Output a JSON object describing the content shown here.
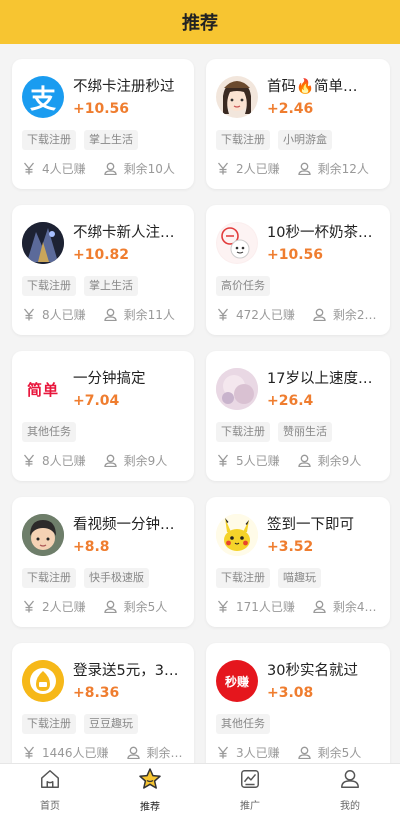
{
  "header": {
    "title": "推荐"
  },
  "cards": [
    {
      "title": "不绑卡注册秒过",
      "reward": "+10.56",
      "tags": [
        "下载注册",
        "掌上生活"
      ],
      "earned": "4人已赚",
      "remaining": "剩余10人",
      "avatar": {
        "type": "alipay",
        "text": "支",
        "bg": "#1a9cf0"
      }
    },
    {
      "title": "首码🔥简单…",
      "reward": "+2.46",
      "tags": [
        "下载注册",
        "小明游盒"
      ],
      "earned": "2人已赚",
      "remaining": "剩余12人",
      "avatar": {
        "type": "girl",
        "text": "",
        "bg": "#f2e6dc"
      }
    },
    {
      "title": "不绑卡新人注…",
      "reward": "+10.82",
      "tags": [
        "下载注册",
        "掌上生活"
      ],
      "earned": "8人已赚",
      "remaining": "剩余11人",
      "avatar": {
        "type": "dark",
        "text": "",
        "bg": "#1d2233"
      }
    },
    {
      "title": "10秒一杯奶茶…",
      "reward": "+10.56",
      "tags": [
        "高价任务"
      ],
      "earned": "472人已赚",
      "remaining": "剩余2…",
      "avatar": {
        "type": "stamp",
        "text": "",
        "bg": "#fbeeee"
      }
    },
    {
      "title": "一分钟搞定",
      "reward": "+7.04",
      "tags": [
        "其他任务"
      ],
      "earned": "8人已赚",
      "remaining": "剩余9人",
      "avatar": {
        "type": "text-red",
        "text": "简单",
        "bg": "#ffffff"
      }
    },
    {
      "title": "17岁以上速度…",
      "reward": "+26.4",
      "tags": [
        "下载注册",
        "赞丽生活"
      ],
      "earned": "5人已赚",
      "remaining": "剩余9人",
      "avatar": {
        "type": "blur",
        "text": "",
        "bg": "#e8d6e2"
      }
    },
    {
      "title": "看视频一分钟…",
      "reward": "+8.8",
      "tags": [
        "下载注册",
        "快手极速版"
      ],
      "earned": "2人已赚",
      "remaining": "剩余5人",
      "avatar": {
        "type": "boy",
        "text": "",
        "bg": "#5d6d5b"
      }
    },
    {
      "title": "签到一下即可",
      "reward": "+3.52",
      "tags": [
        "下载注册",
        "喵趣玩"
      ],
      "earned": "171人已赚",
      "remaining": "剩余4…",
      "avatar": {
        "type": "pikachu",
        "text": "",
        "bg": "#fff7d4"
      }
    },
    {
      "title": "登录送5元，3…",
      "reward": "+8.36",
      "tags": [
        "下载注册",
        "豆豆趣玩"
      ],
      "earned": "1446人已赚",
      "remaining": "剩余…",
      "avatar": {
        "type": "coin",
        "text": "",
        "bg": "#f6b819"
      }
    },
    {
      "title": "30秒实名就过",
      "reward": "+3.08",
      "tags": [
        "其他任务"
      ],
      "earned": "3人已赚",
      "remaining": "剩余5人",
      "avatar": {
        "type": "red-circle",
        "text": "秒赚",
        "bg": "#e5161d"
      }
    }
  ],
  "tabbar": {
    "items": [
      {
        "label": "首页",
        "icon": "home-icon",
        "active": false
      },
      {
        "label": "推荐",
        "icon": "star-icon",
        "active": true
      },
      {
        "label": "推广",
        "icon": "chart-icon",
        "active": false
      },
      {
        "label": "我的",
        "icon": "user-icon",
        "active": false
      }
    ]
  },
  "colors": {
    "accent": "#f7c531",
    "reward": "#ef7d2f"
  }
}
